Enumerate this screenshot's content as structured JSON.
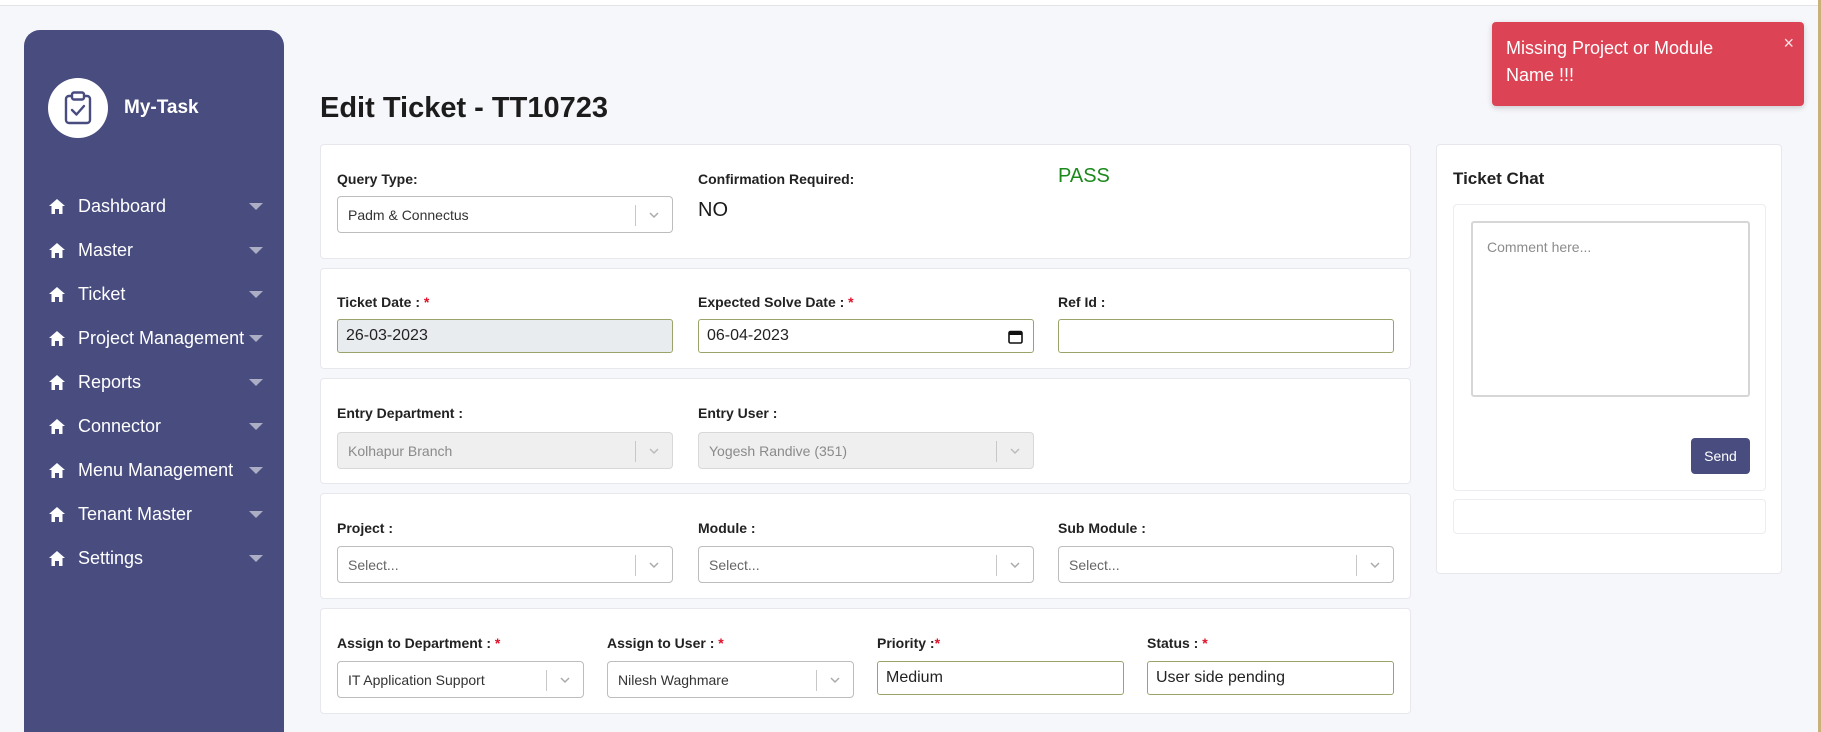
{
  "app": {
    "brand": "My-Task"
  },
  "sidebar": {
    "items": [
      {
        "label": "Dashboard"
      },
      {
        "label": "Master"
      },
      {
        "label": "Ticket"
      },
      {
        "label": "Project Management"
      },
      {
        "label": "Reports"
      },
      {
        "label": "Connector"
      },
      {
        "label": "Menu Management"
      },
      {
        "label": "Tenant Master"
      },
      {
        "label": "Settings"
      }
    ]
  },
  "page": {
    "title": "Edit Ticket - TT10723"
  },
  "query_section": {
    "query_type_label": "Query Type:",
    "query_type_value": "Padm & Connectus",
    "confirmation_label": "Confirmation Required:",
    "confirmation_value": "NO",
    "pass_text": "PASS"
  },
  "dates_section": {
    "ticket_date_label": "Ticket Date : ",
    "ticket_date_value": "26-03-2023",
    "expected_solve_label": "Expected Solve Date : ",
    "expected_solve_value": "06-04-2023",
    "ref_id_label": "Ref Id :",
    "ref_id_value": ""
  },
  "entry_section": {
    "entry_department_label": "Entry Department :",
    "entry_department_value": "Kolhapur Branch",
    "entry_user_label": "Entry User :",
    "entry_user_value": "Yogesh Randive (351)"
  },
  "project_section": {
    "project_label": "Project :",
    "project_placeholder": "Select...",
    "module_label": "Module :",
    "module_placeholder": "Select...",
    "sub_module_label": "Sub Module :",
    "sub_module_placeholder": "Select..."
  },
  "assign_section": {
    "assign_department_label": "Assign to Department : ",
    "assign_department_value": "IT Application Support",
    "assign_user_label": "Assign to User : ",
    "assign_user_value": "Nilesh Waghmare",
    "priority_label": "Priority :",
    "priority_value": "Medium",
    "status_label": "Status : ",
    "status_value": "User side pending"
  },
  "required_marker": "*",
  "chat": {
    "title": "Ticket Chat",
    "comment_placeholder": "Comment here...",
    "send_label": "Send"
  },
  "toast": {
    "message": "Missing Project or Module Name !!!",
    "close_symbol": "×"
  },
  "colors": {
    "sidebar": "#484c7f",
    "toast": "#dc4456",
    "pass": "#1b8a1b",
    "required": "#e0102a"
  }
}
